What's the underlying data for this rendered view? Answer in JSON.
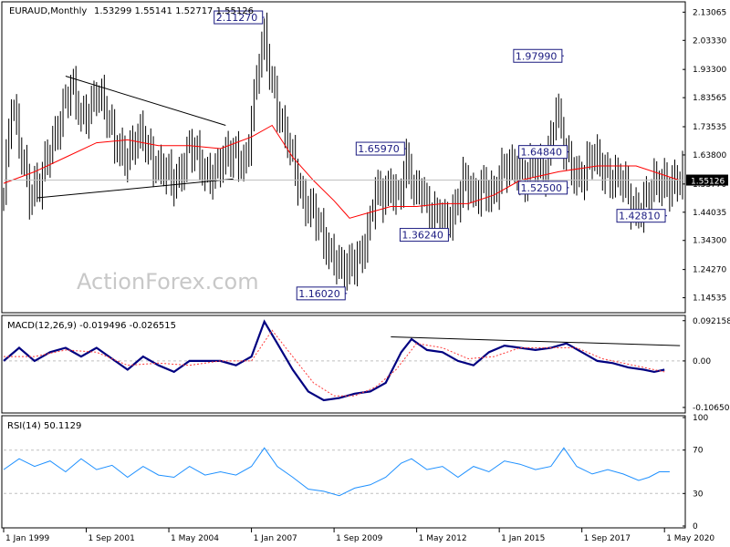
{
  "chart_data": [
    {
      "type": "candlestick",
      "panel": "price",
      "title": "EURAUD,Monthly",
      "ohlc": "1.53299 1.55141 1.52717 1.55126",
      "watermark": "ActionForex.com",
      "ylim": [
        1.1,
        2.16
      ],
      "yticks": [
        "2.13065",
        "2.03330",
        "1.93300",
        "1.83565",
        "1.73535",
        "1.63800",
        "1.53770",
        "1.44035",
        "1.34300",
        "1.24270",
        "1.14535"
      ],
      "ytick_values": [
        2.13065,
        2.0333,
        1.933,
        1.83565,
        1.73535,
        1.638,
        1.5377,
        1.44035,
        1.343,
        1.2427,
        1.14535
      ],
      "last_price": "1.55126",
      "last_price_value": 1.55126,
      "annotations": [
        {
          "text": "2.11270",
          "t": 101,
          "value": 2.1127
        },
        {
          "text": "1.97990",
          "t": 217,
          "value": 1.9799
        },
        {
          "text": "1.65970",
          "t": 156,
          "value": 1.6597
        },
        {
          "text": "1.64840",
          "t": 219,
          "value": 1.6484
        },
        {
          "text": "1.52500",
          "t": 219,
          "value": 1.525
        },
        {
          "text": "1.42810",
          "t": 257,
          "value": 1.4281
        },
        {
          "text": "1.36240",
          "t": 173,
          "value": 1.3624
        },
        {
          "text": "1.16020",
          "t": 133,
          "value": 1.1602
        }
      ],
      "trendlines": [
        {
          "t1": 24,
          "v1": 1.91,
          "t2": 86,
          "v2": 1.74
        },
        {
          "t1": 13,
          "v1": 1.49,
          "t2": 89,
          "v2": 1.555
        }
      ],
      "ma_series": [
        {
          "t": 0,
          "v": 1.54
        },
        {
          "t": 12,
          "v": 1.58
        },
        {
          "t": 24,
          "v": 1.63
        },
        {
          "t": 36,
          "v": 1.68
        },
        {
          "t": 48,
          "v": 1.69
        },
        {
          "t": 60,
          "v": 1.67
        },
        {
          "t": 72,
          "v": 1.67
        },
        {
          "t": 84,
          "v": 1.66
        },
        {
          "t": 96,
          "v": 1.7
        },
        {
          "t": 104,
          "v": 1.74
        },
        {
          "t": 112,
          "v": 1.63
        },
        {
          "t": 120,
          "v": 1.55
        },
        {
          "t": 128,
          "v": 1.48
        },
        {
          "t": 134,
          "v": 1.42
        },
        {
          "t": 142,
          "v": 1.44
        },
        {
          "t": 150,
          "v": 1.46
        },
        {
          "t": 160,
          "v": 1.46
        },
        {
          "t": 170,
          "v": 1.47
        },
        {
          "t": 180,
          "v": 1.47
        },
        {
          "t": 190,
          "v": 1.5
        },
        {
          "t": 200,
          "v": 1.55
        },
        {
          "t": 215,
          "v": 1.58
        },
        {
          "t": 230,
          "v": 1.6
        },
        {
          "t": 245,
          "v": 1.6
        },
        {
          "t": 262,
          "v": 1.55
        }
      ],
      "close_series": [
        {
          "t": 0,
          "v": 1.5
        },
        {
          "t": 3,
          "v": 1.8
        },
        {
          "t": 7,
          "v": 1.65
        },
        {
          "t": 10,
          "v": 1.52
        },
        {
          "t": 14,
          "v": 1.52
        },
        {
          "t": 18,
          "v": 1.66
        },
        {
          "t": 22,
          "v": 1.78
        },
        {
          "t": 26,
          "v": 1.86
        },
        {
          "t": 30,
          "v": 1.77
        },
        {
          "t": 36,
          "v": 1.85
        },
        {
          "t": 42,
          "v": 1.72
        },
        {
          "t": 48,
          "v": 1.62
        },
        {
          "t": 54,
          "v": 1.72
        },
        {
          "t": 60,
          "v": 1.58
        },
        {
          "t": 66,
          "v": 1.55
        },
        {
          "t": 72,
          "v": 1.66
        },
        {
          "t": 78,
          "v": 1.58
        },
        {
          "t": 84,
          "v": 1.6
        },
        {
          "t": 90,
          "v": 1.65
        },
        {
          "t": 94,
          "v": 1.62
        },
        {
          "t": 97,
          "v": 1.82
        },
        {
          "t": 99,
          "v": 1.95
        },
        {
          "t": 101,
          "v": 2.05
        },
        {
          "t": 104,
          "v": 1.9
        },
        {
          "t": 108,
          "v": 1.72
        },
        {
          "t": 112,
          "v": 1.62
        },
        {
          "t": 116,
          "v": 1.5
        },
        {
          "t": 120,
          "v": 1.43
        },
        {
          "t": 124,
          "v": 1.34
        },
        {
          "t": 128,
          "v": 1.3
        },
        {
          "t": 132,
          "v": 1.22
        },
        {
          "t": 135,
          "v": 1.25
        },
        {
          "t": 138,
          "v": 1.3
        },
        {
          "t": 141,
          "v": 1.38
        },
        {
          "t": 144,
          "v": 1.5
        },
        {
          "t": 147,
          "v": 1.48
        },
        {
          "t": 150,
          "v": 1.55
        },
        {
          "t": 153,
          "v": 1.5
        },
        {
          "t": 156,
          "v": 1.6
        },
        {
          "t": 159,
          "v": 1.5
        },
        {
          "t": 162,
          "v": 1.54
        },
        {
          "t": 165,
          "v": 1.45
        },
        {
          "t": 168,
          "v": 1.41
        },
        {
          "t": 171,
          "v": 1.4
        },
        {
          "t": 174,
          "v": 1.45
        },
        {
          "t": 178,
          "v": 1.55
        },
        {
          "t": 182,
          "v": 1.48
        },
        {
          "t": 186,
          "v": 1.55
        },
        {
          "t": 190,
          "v": 1.5
        },
        {
          "t": 194,
          "v": 1.58
        },
        {
          "t": 198,
          "v": 1.62
        },
        {
          "t": 202,
          "v": 1.55
        },
        {
          "t": 206,
          "v": 1.6
        },
        {
          "t": 210,
          "v": 1.6
        },
        {
          "t": 214,
          "v": 1.8
        },
        {
          "t": 217,
          "v": 1.65
        },
        {
          "t": 220,
          "v": 1.6
        },
        {
          "t": 224,
          "v": 1.57
        },
        {
          "t": 228,
          "v": 1.62
        },
        {
          "t": 232,
          "v": 1.6
        },
        {
          "t": 236,
          "v": 1.57
        },
        {
          "t": 240,
          "v": 1.53
        },
        {
          "t": 244,
          "v": 1.45
        },
        {
          "t": 248,
          "v": 1.48
        },
        {
          "t": 252,
          "v": 1.52
        },
        {
          "t": 256,
          "v": 1.55
        },
        {
          "t": 260,
          "v": 1.55
        }
      ]
    },
    {
      "type": "line",
      "panel": "macd",
      "title": "MACD(12,26,9) -0.019496 -0.026515",
      "ylim": [
        -0.115,
        0.1
      ],
      "yticks": [
        "0.092158",
        "0.00",
        "-0.106503"
      ],
      "ytick_values": [
        0.092158,
        0,
        -0.106503
      ],
      "series": [
        {
          "color": "#000080",
          "points": [
            {
              "t": 0,
              "v": 0.0
            },
            {
              "t": 6,
              "v": 0.03
            },
            {
              "t": 12,
              "v": 0.0
            },
            {
              "t": 18,
              "v": 0.02
            },
            {
              "t": 24,
              "v": 0.03
            },
            {
              "t": 30,
              "v": 0.01
            },
            {
              "t": 36,
              "v": 0.03
            },
            {
              "t": 42,
              "v": 0.005
            },
            {
              "t": 48,
              "v": -0.02
            },
            {
              "t": 54,
              "v": 0.01
            },
            {
              "t": 60,
              "v": -0.01
            },
            {
              "t": 66,
              "v": -0.025
            },
            {
              "t": 72,
              "v": 0.0
            },
            {
              "t": 78,
              "v": 0.0
            },
            {
              "t": 84,
              "v": 0.0
            },
            {
              "t": 90,
              "v": -0.01
            },
            {
              "t": 96,
              "v": 0.01
            },
            {
              "t": 101,
              "v": 0.09
            },
            {
              "t": 106,
              "v": 0.04
            },
            {
              "t": 112,
              "v": -0.02
            },
            {
              "t": 118,
              "v": -0.07
            },
            {
              "t": 124,
              "v": -0.09
            },
            {
              "t": 130,
              "v": -0.085
            },
            {
              "t": 136,
              "v": -0.075
            },
            {
              "t": 142,
              "v": -0.07
            },
            {
              "t": 148,
              "v": -0.05
            },
            {
              "t": 154,
              "v": 0.02
            },
            {
              "t": 158,
              "v": 0.05
            },
            {
              "t": 164,
              "v": 0.025
            },
            {
              "t": 170,
              "v": 0.02
            },
            {
              "t": 176,
              "v": 0.0
            },
            {
              "t": 182,
              "v": -0.01
            },
            {
              "t": 188,
              "v": 0.02
            },
            {
              "t": 194,
              "v": 0.035
            },
            {
              "t": 200,
              "v": 0.03
            },
            {
              "t": 206,
              "v": 0.025
            },
            {
              "t": 212,
              "v": 0.03
            },
            {
              "t": 218,
              "v": 0.04
            },
            {
              "t": 224,
              "v": 0.02
            },
            {
              "t": 230,
              "v": 0.0
            },
            {
              "t": 236,
              "v": -0.005
            },
            {
              "t": 242,
              "v": -0.015
            },
            {
              "t": 248,
              "v": -0.02
            },
            {
              "t": 252,
              "v": -0.025
            },
            {
              "t": 256,
              "v": -0.02
            }
          ]
        },
        {
          "color": "#ff3a3a",
          "dashed": true,
          "points": [
            {
              "t": 0,
              "v": 0.01
            },
            {
              "t": 12,
              "v": 0.01
            },
            {
              "t": 24,
              "v": 0.025
            },
            {
              "t": 36,
              "v": 0.02
            },
            {
              "t": 48,
              "v": -0.01
            },
            {
              "t": 60,
              "v": -0.005
            },
            {
              "t": 72,
              "v": -0.01
            },
            {
              "t": 84,
              "v": 0.0
            },
            {
              "t": 96,
              "v": 0.0
            },
            {
              "t": 104,
              "v": 0.07
            },
            {
              "t": 112,
              "v": 0.01
            },
            {
              "t": 120,
              "v": -0.05
            },
            {
              "t": 128,
              "v": -0.08
            },
            {
              "t": 136,
              "v": -0.08
            },
            {
              "t": 144,
              "v": -0.06
            },
            {
              "t": 152,
              "v": -0.02
            },
            {
              "t": 160,
              "v": 0.04
            },
            {
              "t": 170,
              "v": 0.03
            },
            {
              "t": 180,
              "v": 0.005
            },
            {
              "t": 190,
              "v": 0.01
            },
            {
              "t": 200,
              "v": 0.03
            },
            {
              "t": 212,
              "v": 0.03
            },
            {
              "t": 222,
              "v": 0.03
            },
            {
              "t": 232,
              "v": 0.005
            },
            {
              "t": 244,
              "v": -0.01
            },
            {
              "t": 256,
              "v": -0.025
            }
          ]
        }
      ],
      "trendlines": [
        {
          "t1": 150,
          "v1": 0.055,
          "t2": 262,
          "v2": 0.035
        }
      ]
    },
    {
      "type": "line",
      "panel": "rsi",
      "title": "RSI(14) 50.1129",
      "ylim": [
        0,
        100
      ],
      "yticks": [
        "100",
        "70",
        "30",
        "0"
      ],
      "ytick_values": [
        100,
        70,
        30,
        0
      ],
      "series": [
        {
          "color": "#1e90ff",
          "points": [
            {
              "t": 0,
              "v": 52
            },
            {
              "t": 6,
              "v": 62
            },
            {
              "t": 12,
              "v": 55
            },
            {
              "t": 18,
              "v": 60
            },
            {
              "t": 24,
              "v": 50
            },
            {
              "t": 30,
              "v": 62
            },
            {
              "t": 36,
              "v": 52
            },
            {
              "t": 42,
              "v": 56
            },
            {
              "t": 48,
              "v": 45
            },
            {
              "t": 54,
              "v": 55
            },
            {
              "t": 60,
              "v": 47
            },
            {
              "t": 66,
              "v": 45
            },
            {
              "t": 72,
              "v": 55
            },
            {
              "t": 78,
              "v": 47
            },
            {
              "t": 84,
              "v": 50
            },
            {
              "t": 90,
              "v": 47
            },
            {
              "t": 96,
              "v": 55
            },
            {
              "t": 101,
              "v": 72
            },
            {
              "t": 106,
              "v": 55
            },
            {
              "t": 112,
              "v": 45
            },
            {
              "t": 118,
              "v": 34
            },
            {
              "t": 124,
              "v": 32
            },
            {
              "t": 130,
              "v": 28
            },
            {
              "t": 136,
              "v": 35
            },
            {
              "t": 142,
              "v": 38
            },
            {
              "t": 148,
              "v": 45
            },
            {
              "t": 154,
              "v": 58
            },
            {
              "t": 158,
              "v": 62
            },
            {
              "t": 164,
              "v": 52
            },
            {
              "t": 170,
              "v": 55
            },
            {
              "t": 176,
              "v": 45
            },
            {
              "t": 182,
              "v": 55
            },
            {
              "t": 188,
              "v": 50
            },
            {
              "t": 194,
              "v": 60
            },
            {
              "t": 200,
              "v": 57
            },
            {
              "t": 206,
              "v": 52
            },
            {
              "t": 212,
              "v": 55
            },
            {
              "t": 217,
              "v": 72
            },
            {
              "t": 222,
              "v": 55
            },
            {
              "t": 228,
              "v": 48
            },
            {
              "t": 234,
              "v": 52
            },
            {
              "t": 240,
              "v": 48
            },
            {
              "t": 246,
              "v": 42
            },
            {
              "t": 250,
              "v": 45
            },
            {
              "t": 254,
              "v": 50
            },
            {
              "t": 258,
              "v": 50
            }
          ]
        }
      ],
      "levels": [
        70,
        30
      ]
    }
  ],
  "x_axis": {
    "n_months": 264,
    "ticks": [
      {
        "label": "1 Jan 1999",
        "t": 0
      },
      {
        "label": "1 Sep 2001",
        "t": 32
      },
      {
        "label": "1 May 2004",
        "t": 64
      },
      {
        "label": "1 Jan 2007",
        "t": 96
      },
      {
        "label": "1 Sep 2009",
        "t": 128
      },
      {
        "label": "1 May 2012",
        "t": 160
      },
      {
        "label": "1 Jan 2015",
        "t": 192
      },
      {
        "label": "1 Sep 2017",
        "t": 224
      },
      {
        "label": "1 May 2020",
        "t": 256
      }
    ]
  },
  "colors": {
    "candle": "#000000",
    "ma": "#ff0000",
    "macd": "#000080",
    "signal": "#ff3a3a",
    "rsi": "#1e90ff",
    "grid": "#c0c0c0",
    "label": "#1a1a80",
    "last_price_bg": "#000000"
  }
}
